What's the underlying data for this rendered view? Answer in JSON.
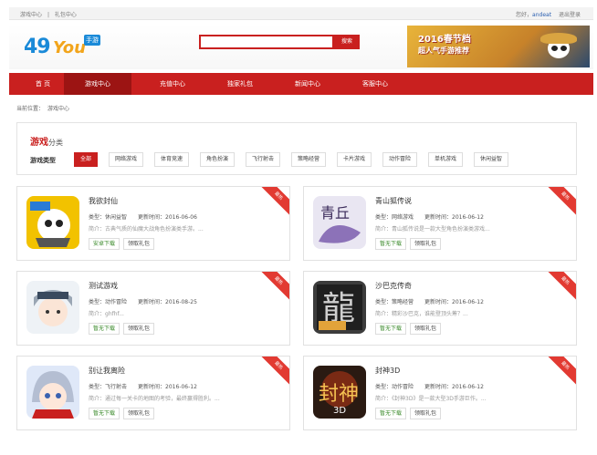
{
  "topbar": {
    "links": [
      "游戏中心",
      "礼包中心"
    ],
    "user_greeting": "您好，",
    "user_name": "andeat",
    "logout": "退出登录"
  },
  "header": {
    "logo": {
      "part1": "49",
      "part2": "You",
      "badge": "手游"
    },
    "search": {
      "placeholder": "",
      "button": "搜索"
    },
    "banner": {
      "line1": "2016春节档",
      "line2": "超人气手游推荐"
    }
  },
  "nav": {
    "items": [
      "首 页",
      "游戏中心",
      "充值中心",
      "独家礼包",
      "新闻中心",
      "客服中心"
    ],
    "active_index": 1
  },
  "breadcrumb": {
    "prefix": "当前位置：",
    "current": "游戏中心"
  },
  "category": {
    "title": "游戏",
    "title_suffix": "分类",
    "type_label": "游戏类型",
    "tags": [
      "全部",
      "网络游戏",
      "体育竞速",
      "角色扮演",
      "飞行射击",
      "策略经营",
      "卡片游戏",
      "动作冒险",
      "单机游戏",
      "休闲益智"
    ],
    "active_index": 0
  },
  "labels": {
    "type": "类型：",
    "update": "更新时间：",
    "intro": "简介：",
    "gift": "领取礼包",
    "ribbon": "最热"
  },
  "games": [
    {
      "name": "我欲封仙",
      "type": "休闲益智",
      "date": "2016-06-06",
      "intro": "古典气质的仙魔大战角色扮演类手游。...",
      "download": "安卓下载"
    },
    {
      "name": "青山狐传说",
      "type": "网络游戏",
      "date": "2016-06-12",
      "intro": "青山狐传说是一款大型角色扮演类游戏...",
      "download": "暂无下载"
    },
    {
      "name": "测试游戏",
      "type": "动作冒险",
      "date": "2016-08-25",
      "intro": "ghfhf...",
      "download": "暂无下载"
    },
    {
      "name": "沙巴克传奇",
      "type": "策略经营",
      "date": "2016-06-12",
      "intro": "精彩沙巴克，谁能登顶头筹？...",
      "download": "暂无下载"
    },
    {
      "name": "别让我离险",
      "type": "飞行射击",
      "date": "2016-06-12",
      "intro": "通过每一关卡的地图的考验，最终赢得胜利。...",
      "download": "暂无下载"
    },
    {
      "name": "封神3D",
      "type": "动作冒险",
      "date": "2016-06-12",
      "intro": "《封神3D》是一款大型3D手游巨作。...",
      "download": "暂无下载"
    }
  ],
  "colors": {
    "accent": "#c9201f",
    "accent_dark": "#9c1413",
    "ribbon": "#e23a32",
    "download_text": "#3a8a2a"
  },
  "icons": [
    "pvp-hero-icon",
    "fox-legend-icon",
    "anime-boy-icon",
    "dragon-glyph-icon",
    "anime-girl-icon",
    "fengshen-icon"
  ]
}
